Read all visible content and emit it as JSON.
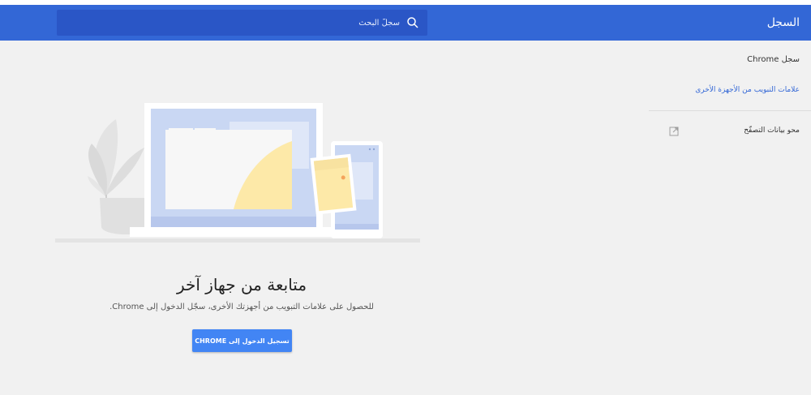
{
  "toolbar": {
    "title": "السجل",
    "search_placeholder": "سجلّ البحث",
    "search_icon": "search-icon"
  },
  "sidebar": {
    "history_label": "سجل Chrome",
    "tabs_from_other_devices": "علامات التبويب من الأجهزة الأخرى",
    "clear_browsing_data": "محو بيانات التصفّح",
    "external_link_icon": "open-in-new-icon"
  },
  "main": {
    "heading": "متابعة من جهاز آخر",
    "description": "للحصول على علامات التبويب من أجهزتك الأخرى، سجّل الدخول إلى Chrome.",
    "signin_button": "تسجيل الدخول إلى CHROME"
  },
  "colors": {
    "toolbar": "#3367d6",
    "search_bg": "#2a56c6",
    "accent": "#4285f4",
    "page_bg": "#f1f1f1"
  }
}
